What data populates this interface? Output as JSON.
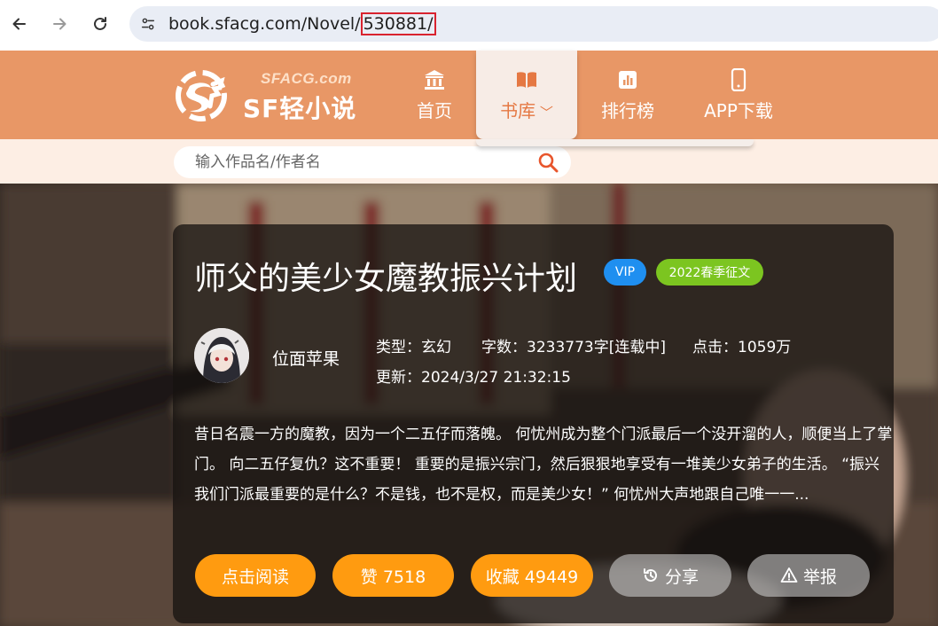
{
  "browser": {
    "url_prefix": "book.sfacg.com/Novel/",
    "url_highlight": "530881/"
  },
  "header": {
    "logo_brand": "SFACG.com",
    "logo_name": "SF轻小说",
    "nav": [
      {
        "label": "首页",
        "icon": "bank-icon"
      },
      {
        "label": "书库",
        "icon": "book-icon",
        "active": true
      },
      {
        "label": "排行榜",
        "icon": "chart-icon"
      },
      {
        "label": "APP下载",
        "icon": "phone-icon"
      }
    ],
    "accent_color": "#e89766"
  },
  "search": {
    "placeholder": "输入作品名/作者名"
  },
  "book": {
    "title": "师父的美少女魔教振兴计划",
    "badges": [
      "VIP",
      "2022春季征文"
    ],
    "author": "位面苹果",
    "type": "类型：玄幻",
    "word_count": "字数：3233773字[连载中]",
    "clicks": "点击：1059万",
    "updated": "更新：2024/3/27 21:32:15",
    "description_lines": [
      "昔日名震一方的魔教，因为一个二五仔而落魄。 何忧州成为整个门派最后一个没开溜的人，顺便当上了掌",
      "门。 向二五仔复仇？这不重要！ 重要的是振兴宗门，然后狠狠地享受有一堆美少女弟子的生活。 “振兴",
      "我们门派最重要的是什么？不是钱，也不是权，而是美少女！” 何忧州大声地跟自己唯一一..."
    ]
  },
  "actions": {
    "read": "点击阅读",
    "like": "赞 7518",
    "favorite": "收藏 49449",
    "share": "分享",
    "report": "举报"
  },
  "colors": {
    "orange_button": "#ff9b10",
    "vip_badge": "#1f8ff0",
    "event_badge": "#7cc520"
  }
}
